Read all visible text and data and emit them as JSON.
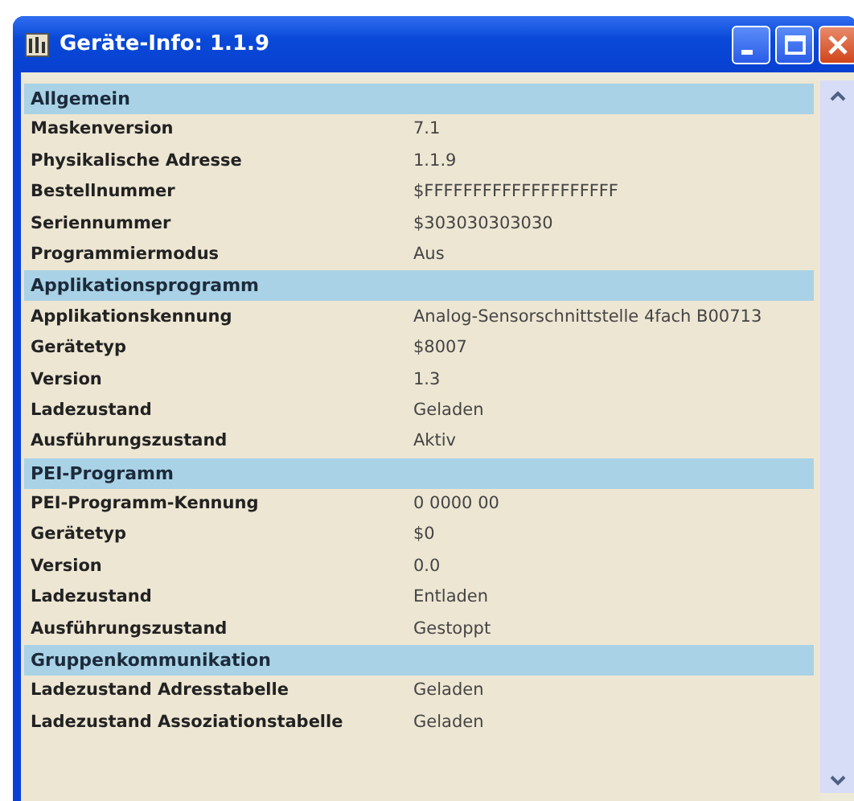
{
  "window": {
    "title": "Geräte-Info: 1.1.9"
  },
  "sections": [
    {
      "title": "Allgemein",
      "rows": [
        {
          "label": "Maskenversion",
          "value": "7.1"
        },
        {
          "label": "Physikalische Adresse",
          "value": "1.1.9"
        },
        {
          "label": "Bestellnummer",
          "value": "$FFFFFFFFFFFFFFFFFFFF"
        },
        {
          "label": "Seriennummer",
          "value": "$303030303030"
        },
        {
          "label": "Programmiermodus",
          "value": "Aus"
        }
      ]
    },
    {
      "title": "Applikationsprogramm",
      "rows": [
        {
          "label": "Applikationskennung",
          "value": "Analog-Sensorschnittstelle 4fach B00713"
        },
        {
          "label": "Gerätetyp",
          "value": "$8007"
        },
        {
          "label": "Version",
          "value": "1.3"
        },
        {
          "label": "Ladezustand",
          "value": "Geladen"
        },
        {
          "label": "Ausführungszustand",
          "value": "Aktiv"
        }
      ]
    },
    {
      "title": "PEI-Programm",
      "rows": [
        {
          "label": "PEI-Programm-Kennung",
          "value": "0 0000 00"
        },
        {
          "label": "Gerätetyp",
          "value": "$0"
        },
        {
          "label": "Version",
          "value": "0.0"
        },
        {
          "label": "Ladezustand",
          "value": "Entladen"
        },
        {
          "label": "Ausführungszustand",
          "value": "Gestoppt"
        }
      ]
    },
    {
      "title": "Gruppenkommunikation",
      "rows": [
        {
          "label": "Ladezustand Adresstabelle",
          "value": "Geladen"
        },
        {
          "label": "Ladezustand Assoziationstabelle",
          "value": "Geladen"
        }
      ]
    }
  ]
}
